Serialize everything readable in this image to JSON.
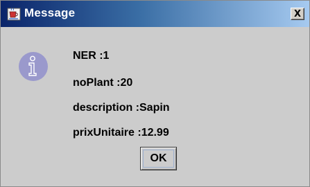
{
  "window": {
    "title": "Message",
    "close_label": "X"
  },
  "message": {
    "lines": [
      "NER :1",
      "noPlant :20",
      "description :Sapin",
      "prixUnitaire :12.99"
    ]
  },
  "buttons": {
    "ok_label": "OK"
  },
  "icons": {
    "title": "java-coffee-cup-icon",
    "message": "information-icon"
  },
  "colors": {
    "title_gradient_start": "#0a246a",
    "title_gradient_end": "#a6caf0",
    "dialog_background": "#cccccc",
    "info_icon": "#9a99cc"
  }
}
